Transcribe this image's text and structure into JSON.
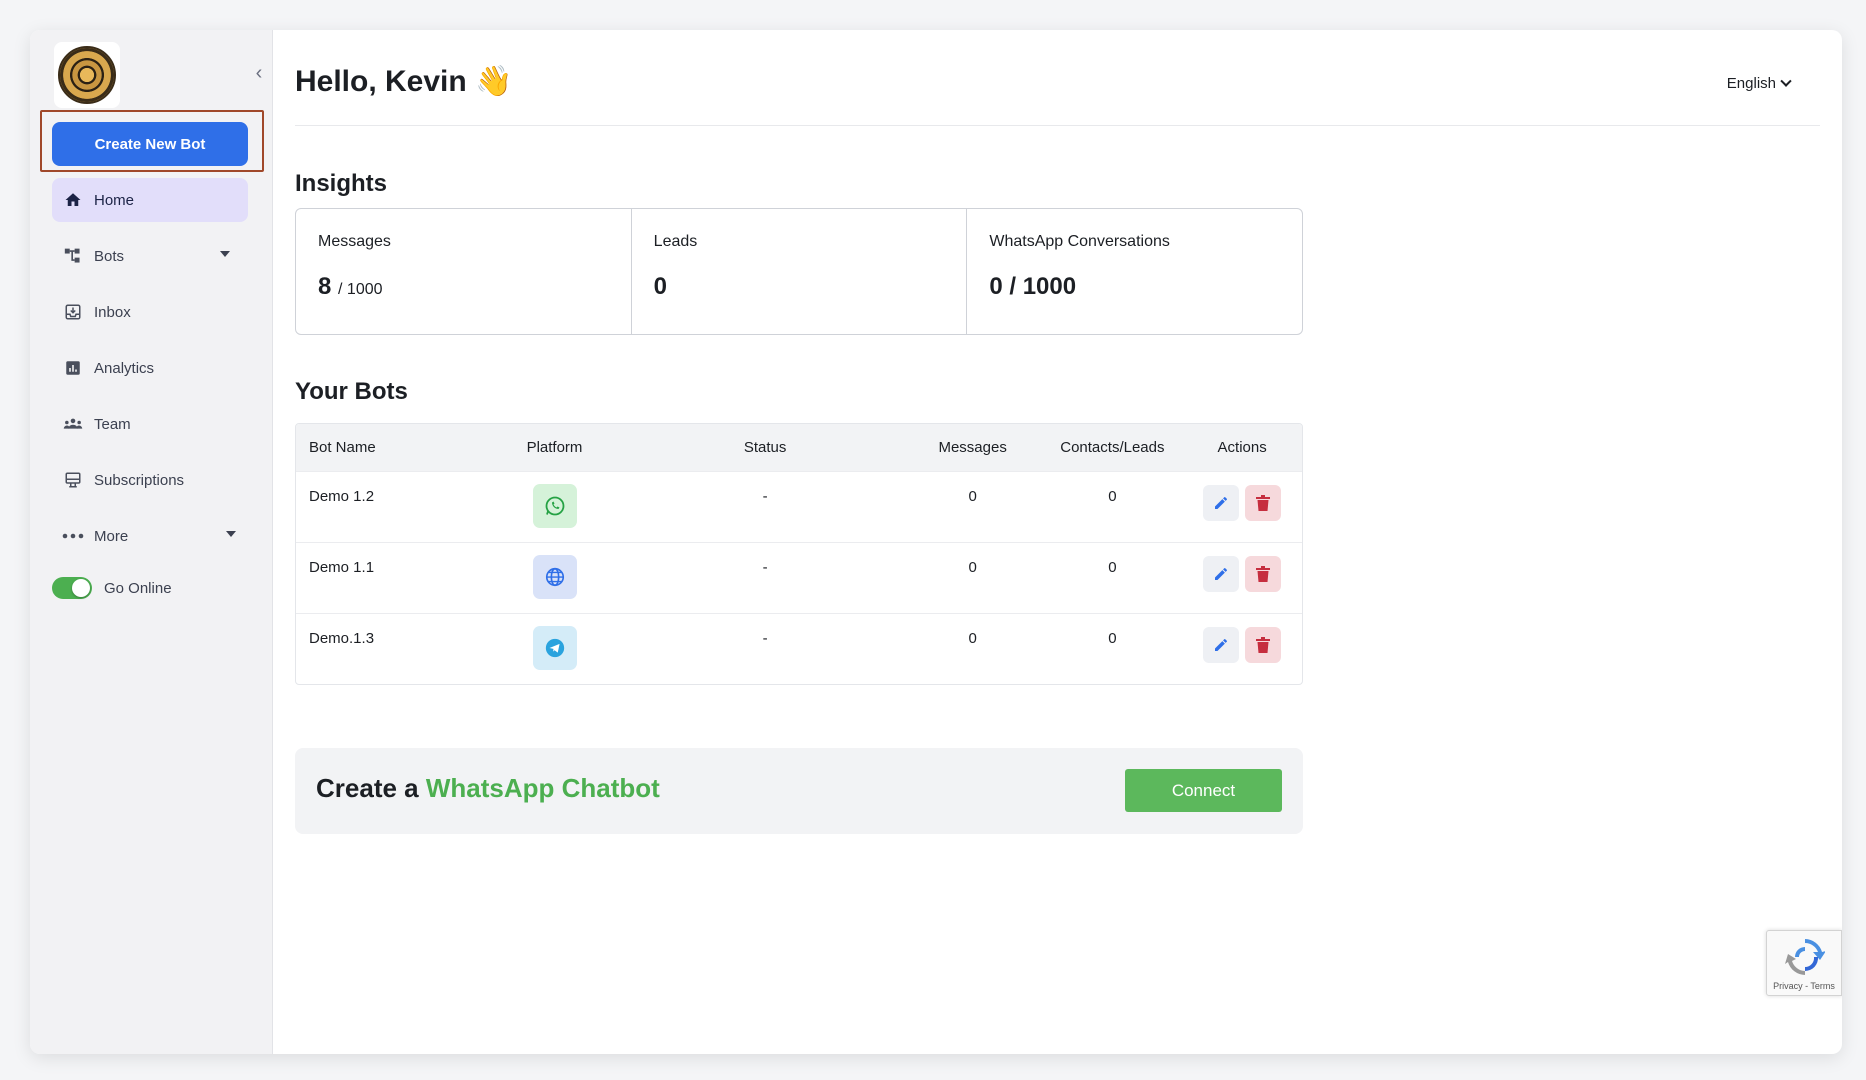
{
  "sidebar": {
    "create_button": "Create New Bot",
    "items": [
      {
        "label": "Home"
      },
      {
        "label": "Bots"
      },
      {
        "label": "Inbox"
      },
      {
        "label": "Analytics"
      },
      {
        "label": "Team"
      },
      {
        "label": "Subscriptions"
      },
      {
        "label": "More"
      }
    ],
    "online_label": "Go Online"
  },
  "header": {
    "greeting": "Hello, Kevin 👋",
    "language": "English"
  },
  "insights": {
    "title": "Insights",
    "cards": [
      {
        "label": "Messages",
        "value": "8",
        "suffix": "/ 1000"
      },
      {
        "label": "Leads",
        "value": "0",
        "suffix": ""
      },
      {
        "label": "WhatsApp Conversations",
        "value": "0 / 1000",
        "suffix": ""
      }
    ]
  },
  "bots": {
    "title": "Your Bots",
    "columns": [
      "Bot Name",
      "Platform",
      "Status",
      "Messages",
      "Contacts/Leads",
      "Actions"
    ],
    "rows": [
      {
        "name": "Demo 1.2",
        "platform": "whatsapp-icon",
        "status": "-",
        "messages": "0",
        "leads": "0"
      },
      {
        "name": "Demo 1.1",
        "platform": "globe-icon",
        "status": "-",
        "messages": "0",
        "leads": "0"
      },
      {
        "name": "Demo.1.3",
        "platform": "telegram-icon",
        "status": "-",
        "messages": "0",
        "leads": "0"
      }
    ]
  },
  "cta": {
    "prefix": "Create a",
    "highlight": "WhatsApp Chatbot",
    "button": "Connect"
  },
  "recaptcha": {
    "links": "Privacy - Terms"
  },
  "colors": {
    "primary": "#2f6fe8",
    "accent_green": "#4caf50",
    "active_nav": "#e2defa",
    "delete": "#c62e3f"
  }
}
